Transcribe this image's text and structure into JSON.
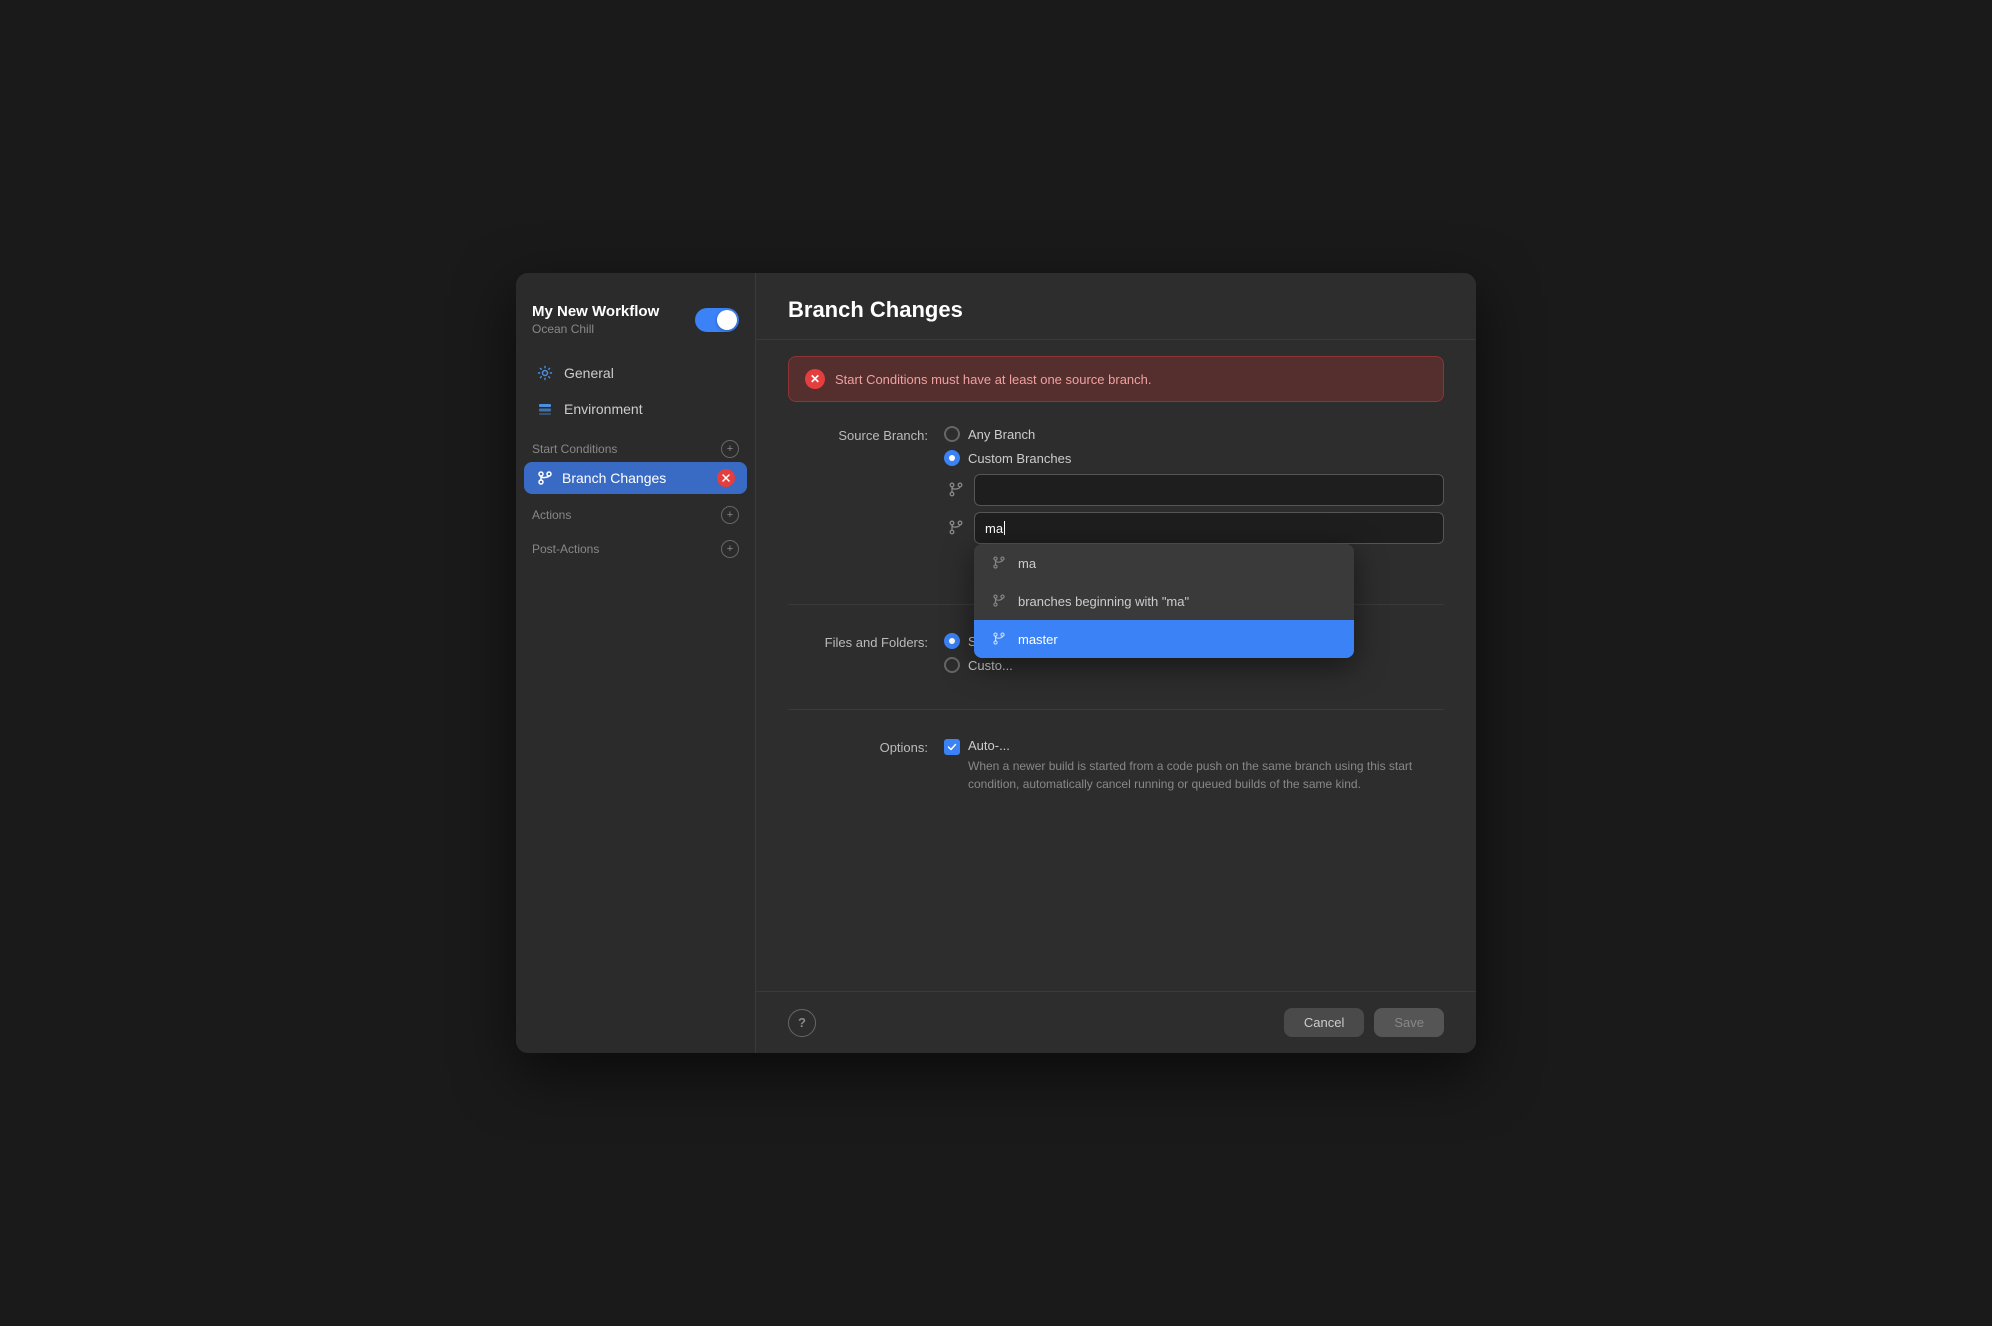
{
  "window": {
    "title": "Branch Changes"
  },
  "sidebar": {
    "workflow_name": "My New Workflow",
    "workflow_subtitle": "Ocean Chill",
    "toggle_on": true,
    "nav_items": [
      {
        "id": "general",
        "label": "General",
        "icon": "gear-icon"
      },
      {
        "id": "environment",
        "label": "Environment",
        "icon": "layers-icon"
      }
    ],
    "sections": [
      {
        "id": "start-conditions",
        "label": "Start Conditions",
        "items": [
          {
            "id": "branch-changes",
            "label": "Branch Changes",
            "selected": true
          }
        ]
      },
      {
        "id": "actions",
        "label": "Actions",
        "items": []
      },
      {
        "id": "post-actions",
        "label": "Post-Actions",
        "items": []
      }
    ]
  },
  "main": {
    "title": "Branch Changes",
    "error_message": "Start Conditions must have at least one source branch.",
    "source_branch": {
      "label": "Source Branch:",
      "options": [
        {
          "id": "any",
          "label": "Any Branch",
          "selected": false
        },
        {
          "id": "custom",
          "label": "Custom Branches",
          "selected": true
        }
      ],
      "branches": [
        {
          "value": ""
        }
      ],
      "typing_value": "ma"
    },
    "dropdown": {
      "items": [
        {
          "id": "ma",
          "label": "ma",
          "type": "exact"
        },
        {
          "id": "beginning",
          "label": "branches beginning with \"ma\"",
          "type": "pattern"
        },
        {
          "id": "master",
          "label": "master",
          "type": "branch",
          "highlighted": true
        }
      ]
    },
    "files_folders": {
      "label": "Files and Folders:",
      "options": [
        {
          "id": "start",
          "label": "Start...",
          "selected": true
        },
        {
          "id": "custom",
          "label": "Custo...",
          "selected": false
        }
      ]
    },
    "options": {
      "label": "Options:",
      "checkbox_label": "Auto-...",
      "checkbox_checked": true,
      "checkbox_desc": "When a newer build is started from a code push on the same branch using this start condition, automatically cancel running or queued builds of the same kind."
    }
  },
  "footer": {
    "help_label": "?",
    "cancel_label": "Cancel",
    "save_label": "Save"
  }
}
